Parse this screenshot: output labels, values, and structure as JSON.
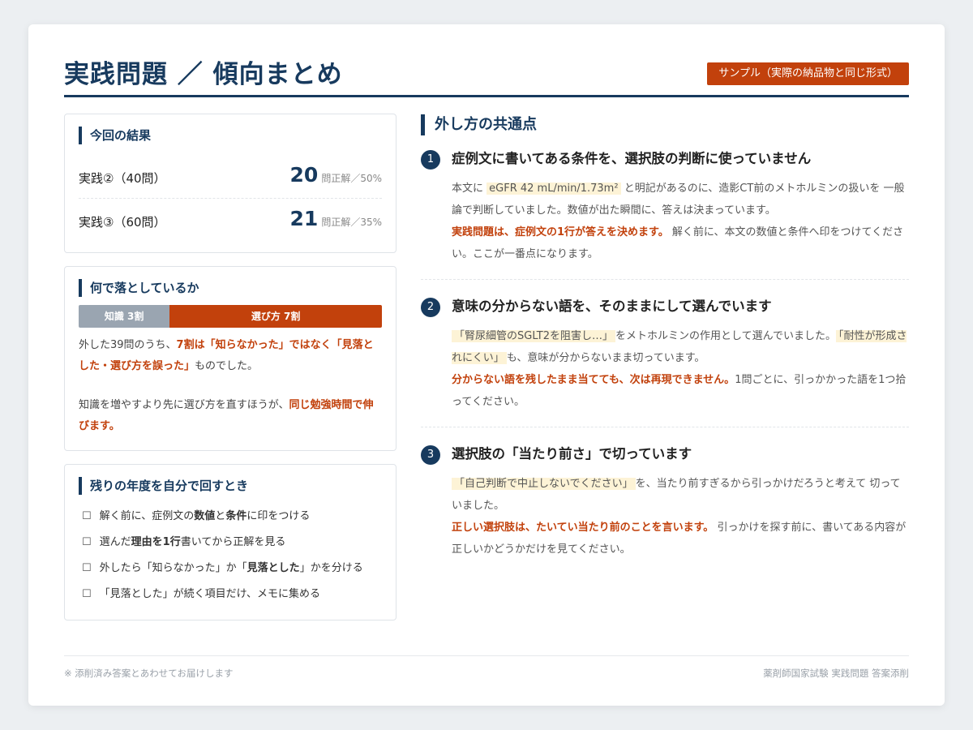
{
  "title": "実践問題 ／ 傾向まとめ",
  "badge": "サンプル（実際の納品物と同じ形式）",
  "results": {
    "heading": "今回の結果",
    "rows": [
      {
        "label": "実践②（40問）",
        "value": "20",
        "unit": "問正解／50%"
      },
      {
        "label": "実践③（60問）",
        "value": "21",
        "unit": "問正解／35%"
      }
    ]
  },
  "cause": {
    "heading": "何で落としているか",
    "bar": [
      {
        "label": "知識 3割",
        "share": 0.3
      },
      {
        "label": "選び方 7割",
        "share": 0.7
      }
    ],
    "p1": [
      "外した39問のうち、",
      "7割は「知らなかった」ではなく「見落とした・選び方を誤った」",
      "ものでした。"
    ],
    "p2": [
      "知識を増やすより先に選び方を直すほうが、",
      "同じ勉強時間で伸びます。"
    ]
  },
  "self_review": {
    "heading": "残りの年度を自分で回すとき",
    "checkbox": "☐",
    "items": [
      [
        "解く前に、症例文の",
        "数値",
        "と",
        "条件",
        "に印をつける"
      ],
      [
        "選んだ",
        "理由を1行",
        "書いてから正解を見る"
      ],
      [
        "外したら「知らなかった」か「",
        "見落とした",
        "」かを分ける"
      ],
      [
        "「見落とした」が続く項目だけ、メモに集める"
      ]
    ]
  },
  "section_title": "外し方の共通点",
  "points": [
    {
      "num": "1",
      "title": "症例文に書いてある条件を、選択肢の判断に使っていません",
      "parts": [
        "本文に",
        "eGFR 42 mL/min/1.73m²",
        "と明記があるのに、造影CT前のメトホルミンの扱いを 一般論で判断していました。数値が出た瞬間に、答えは決まっています。"
      ],
      "emph": "実践問題は、症例文の1行が答えを決めます。",
      "tail": "解く前に、本文の数値と条件へ印をつけてください。ここが一番点になります。"
    },
    {
      "num": "2",
      "title": "意味の分からない語を、そのままにして選んでいます",
      "parts": [
        "「腎尿細管のSGLT2を阻害し…」",
        "をメトホルミンの作用として選んでいました。",
        "「耐性が形成されにくい」",
        "も、意味が分からないまま切っています。"
      ],
      "emph": "分からない語を残したまま当てても、次は再現できません。",
      "tail": "1問ごとに、引っかかった語を1つ拾ってください。"
    },
    {
      "num": "3",
      "title": "選択肢の「当たり前さ」で切っています",
      "parts": [
        "「自己判断で中止しないでください」",
        "を、当たり前すぎるから引っかけだろうと考えて 切っていました。"
      ],
      "emph": "正しい選択肢は、たいてい当たり前のことを言います。",
      "tail": "引っかけを探す前に、書いてある内容が正しいかどうかだけを見てください。"
    }
  ],
  "footer": {
    "left": "※ 添削済み答案とあわせてお届けします",
    "right": "薬剤師国家試験 実践問題 答案添削"
  },
  "colors": {
    "navy": "#173a5e",
    "accent": "#c2410c",
    "muted": "#9aa5b1",
    "highlight": "#fdf3d6"
  }
}
